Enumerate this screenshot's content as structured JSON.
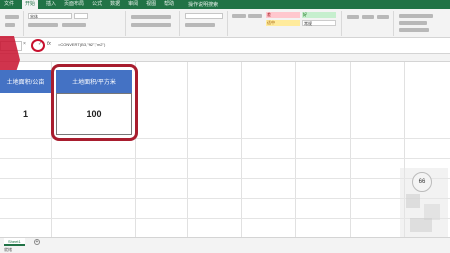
{
  "tabs": [
    "文件",
    "开始",
    "插入",
    "页面布局",
    "公式",
    "数据",
    "审阅",
    "视图",
    "帮助"
  ],
  "tell_me": "操作说明搜索",
  "ribbon": {
    "font_name": "宋体",
    "style_bad": "差",
    "style_good": "好",
    "style_neutral": "适中",
    "style_normal": "常规"
  },
  "formula_bar": {
    "cancel_symbol": "×",
    "confirm_symbol": "✓",
    "fx_label": "fx",
    "formula": "=CONVERT(B3,\"ft2\",\"m2\")"
  },
  "table": {
    "header_a": "土地面积/公亩",
    "header_b": "土地面积/平方米",
    "value_a": "1",
    "value_b": "100"
  },
  "badge": "66",
  "sheet_tab": "Sheet1",
  "add_sheet_symbol": "+",
  "status": "就绪"
}
